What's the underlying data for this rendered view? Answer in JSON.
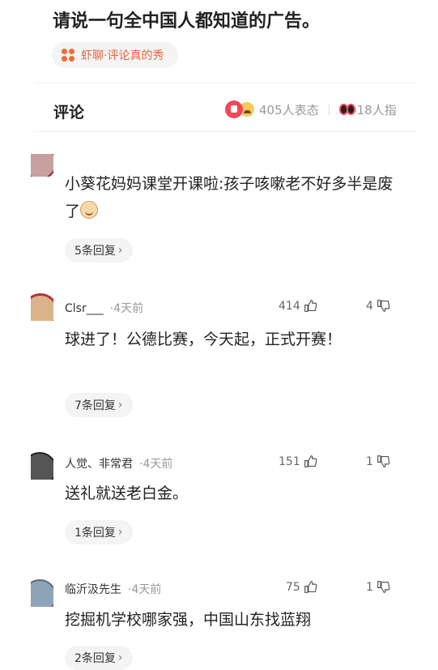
{
  "question": {
    "title": "请说一句全中国人都知道的广告。"
  },
  "topic_tag": {
    "label": "虾聊·评论真的秀",
    "color": "#f06a3b"
  },
  "comments_header": {
    "label": "评论",
    "reactions_count": "405人表态",
    "second_count": "18人指"
  },
  "comments": [
    {
      "author": "",
      "time": "",
      "likes": "",
      "dislikes": "",
      "text": "小葵花妈妈课堂开课啦:孩子咳嗽老不好多半是废了",
      "replies": "5条回复"
    },
    {
      "author": "Clsr___",
      "time": "·4天前",
      "likes": "414",
      "dislikes": "4",
      "text": "球进了！公德比赛，今天起，正式开赛！",
      "replies": "7条回复"
    },
    {
      "author": "人觉、非常君",
      "time": "·4天前",
      "likes": "151",
      "dislikes": "1",
      "text": "送礼就送老白金。",
      "replies": "1条回复"
    },
    {
      "author": "临沂汲先生",
      "time": "·4天前",
      "likes": "75",
      "dislikes": "1",
      "text": "挖掘机学校哪家强，中国山东找蓝翔",
      "replies": "2条回复"
    }
  ]
}
